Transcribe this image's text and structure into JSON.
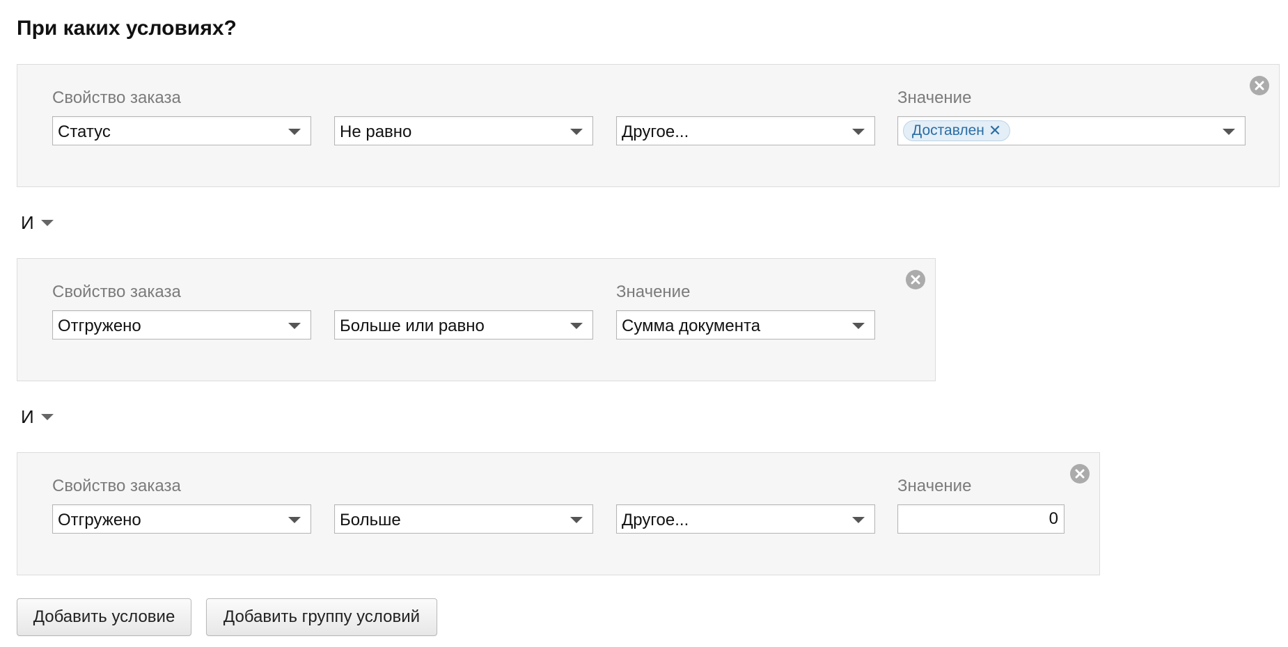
{
  "heading": "При каких условиях?",
  "conditions": [
    {
      "property_label": "Свойство заказа",
      "value_label": "Значение",
      "property": "Статус",
      "operator": "Не равно",
      "compare_source": "Другое...",
      "tag_value": "Доставлен",
      "tag_remove": "✕"
    },
    {
      "property_label": "Свойство заказа",
      "value_label": "Значение",
      "property": "Отгружено",
      "operator": "Больше или равно",
      "value_select": "Сумма документа"
    },
    {
      "property_label": "Свойство заказа",
      "value_label": "Значение",
      "property": "Отгружено",
      "operator": "Больше",
      "compare_source": "Другое...",
      "value_input": "0"
    }
  ],
  "connectors": [
    "И",
    "И"
  ],
  "buttons": {
    "add_condition": "Добавить условие",
    "add_group": "Добавить группу условий"
  },
  "icons": {
    "remove": "close-circle-icon",
    "dropdown": "chevron-down-icon"
  },
  "colors": {
    "block_bg": "#f6f6f6",
    "tag_bg": "#e3eef7",
    "tag_text": "#2a6da3",
    "remove_icon": "#ababab"
  }
}
